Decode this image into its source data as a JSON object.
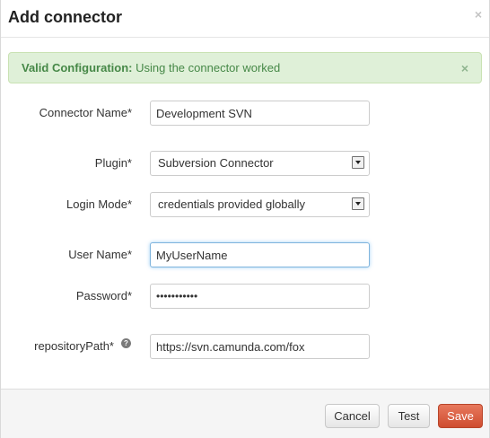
{
  "dialog": {
    "title": "Add connector",
    "close_glyph": "×"
  },
  "alert": {
    "strong": "Valid Configuration:",
    "message": " Using the connector worked",
    "close_glyph": "×",
    "color": "#468847",
    "background": "#dff0d8"
  },
  "form": {
    "connector_name": {
      "label": "Connector Name*",
      "value": "Development SVN"
    },
    "plugin": {
      "label": "Plugin*",
      "value": "Subversion Connector"
    },
    "login_mode": {
      "label": "Login Mode*",
      "value": "credentials provided globally"
    },
    "user_name": {
      "label": "User Name*",
      "value": "MyUserName"
    },
    "password": {
      "label": "Password*",
      "value": "•••••••••••"
    },
    "repository_path": {
      "label": "repositoryPath*",
      "value": "https://svn.camunda.com/fox",
      "help_glyph": "?"
    }
  },
  "footer": {
    "cancel_label": "Cancel",
    "test_label": "Test",
    "save_label": "Save",
    "save_color": "#d9593c"
  }
}
